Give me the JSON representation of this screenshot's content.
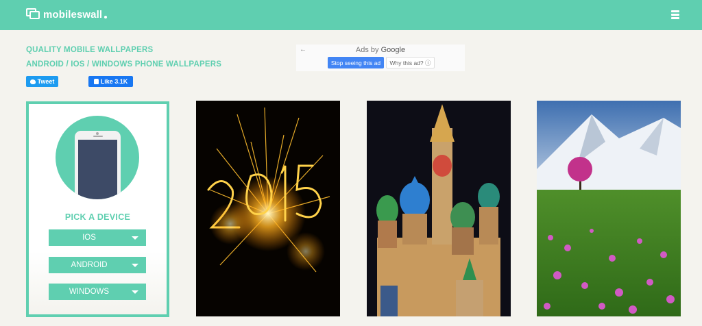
{
  "header": {
    "logo_text": "mobileswall",
    "logo_icon": "overlapping-screens-icon",
    "menu_icon": "hamburger-menu-icon"
  },
  "taglines": {
    "line1": "QUALITY MOBILE WALLPAPERS",
    "line2": "ANDROID / IOS / WINDOWS PHONE WALLPAPERS"
  },
  "social": {
    "tweet_label": "Tweet",
    "like_label": "Like 3.1K"
  },
  "ad": {
    "label_prefix": "Ads by",
    "label_brand": "Google",
    "stop_label": "Stop seeing this ad",
    "why_label": "Why this ad? ⓘ",
    "back_icon": "←"
  },
  "picker": {
    "title": "PICK A DEVICE",
    "devices": [
      {
        "label": "IOS"
      },
      {
        "label": "ANDROID"
      },
      {
        "label": "WINDOWS"
      }
    ]
  },
  "wallpapers": [
    {
      "subject": "fireworks-2015"
    },
    {
      "subject": "st-basils-cathedral"
    },
    {
      "subject": "snowy-mountain-meadow"
    }
  ],
  "colors": {
    "accent": "#5fcfb0",
    "background": "#f4f3ee",
    "twitter": "#1d9bf0",
    "facebook": "#1877f2",
    "google_blue": "#4285f4"
  }
}
